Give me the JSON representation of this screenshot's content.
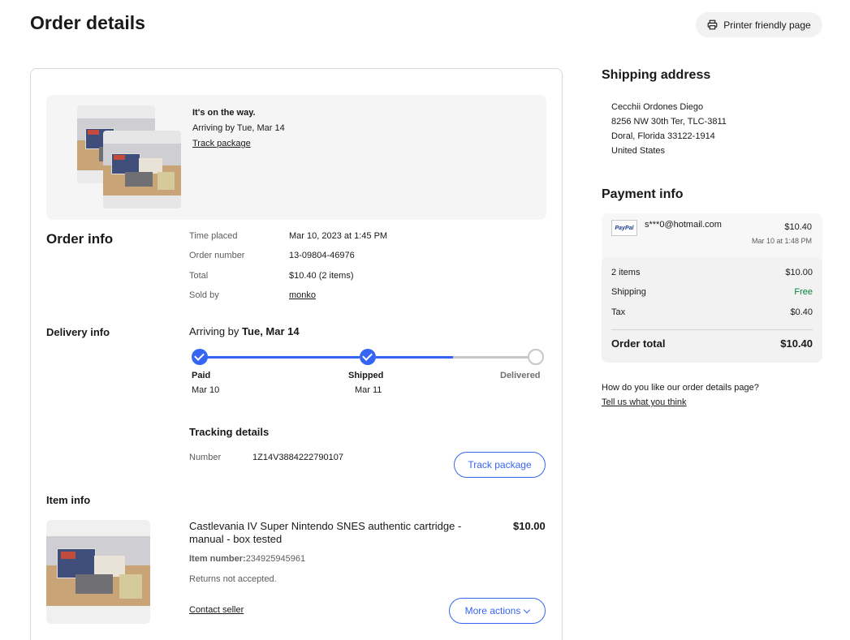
{
  "header": {
    "title": "Order details",
    "printer_label": "Printer friendly page"
  },
  "status": {
    "headline": "It's on the way.",
    "arriving": "Arriving by Tue, Mar 14",
    "track_link": "Track package"
  },
  "order_info": {
    "title": "Order info",
    "rows": [
      {
        "label": "Time placed",
        "value": "Mar 10, 2023 at 1:45 PM"
      },
      {
        "label": "Order number",
        "value": "13-09804-46976"
      },
      {
        "label": "Total",
        "value": "$10.40 (2 items)"
      },
      {
        "label": "Sold by",
        "value": "monko"
      }
    ]
  },
  "delivery": {
    "title": "Delivery info",
    "arriving_prefix": "Arriving by",
    "arriving_date": "Tue, Mar 14",
    "steps": [
      {
        "label": "Paid",
        "date": "Mar 10",
        "done": true
      },
      {
        "label": "Shipped",
        "date": "Mar 11",
        "done": true
      },
      {
        "label": "Delivered",
        "date": "",
        "done": false
      }
    ],
    "tracking_title": "Tracking details",
    "number_label": "Number",
    "number_value": "1Z14V3884222790107",
    "track_button": "Track package"
  },
  "item": {
    "section_title": "Item info",
    "title": "Castlevania IV Super Nintendo SNES authentic cartridge - manual - box tested",
    "price": "$10.00",
    "number_label": "Item number:",
    "number_value": "234925945961",
    "returns": "Returns not accepted.",
    "contact": "Contact seller",
    "more_actions": "More actions"
  },
  "shipping": {
    "title": "Shipping address",
    "lines": [
      "Cecchii Ordones Diego",
      "8256 NW 30th Ter, TLC-3811",
      "Doral, Florida 33122-1914",
      "United States"
    ]
  },
  "payment": {
    "title": "Payment info",
    "paypal_logo_text": "PayPal",
    "email": "s***0@hotmail.com",
    "amount": "$10.40",
    "date": "Mar 10 at 1:48 PM",
    "rows": [
      {
        "label": "2 items",
        "value": "$10.00"
      },
      {
        "label": "Shipping",
        "value": "Free"
      },
      {
        "label": "Tax",
        "value": "$0.40"
      }
    ],
    "total_label": "Order total",
    "total_value": "$10.40"
  },
  "feedback": {
    "question": "How do you like our order details page?",
    "link": "Tell us what you think"
  },
  "colors": {
    "accent": "#3665f3",
    "free": "#05823f",
    "progress_inactive": "#c7c7c7"
  },
  "icons": [
    "printer-icon",
    "check-icon",
    "chevron-down-icon",
    "paypal-logo"
  ]
}
